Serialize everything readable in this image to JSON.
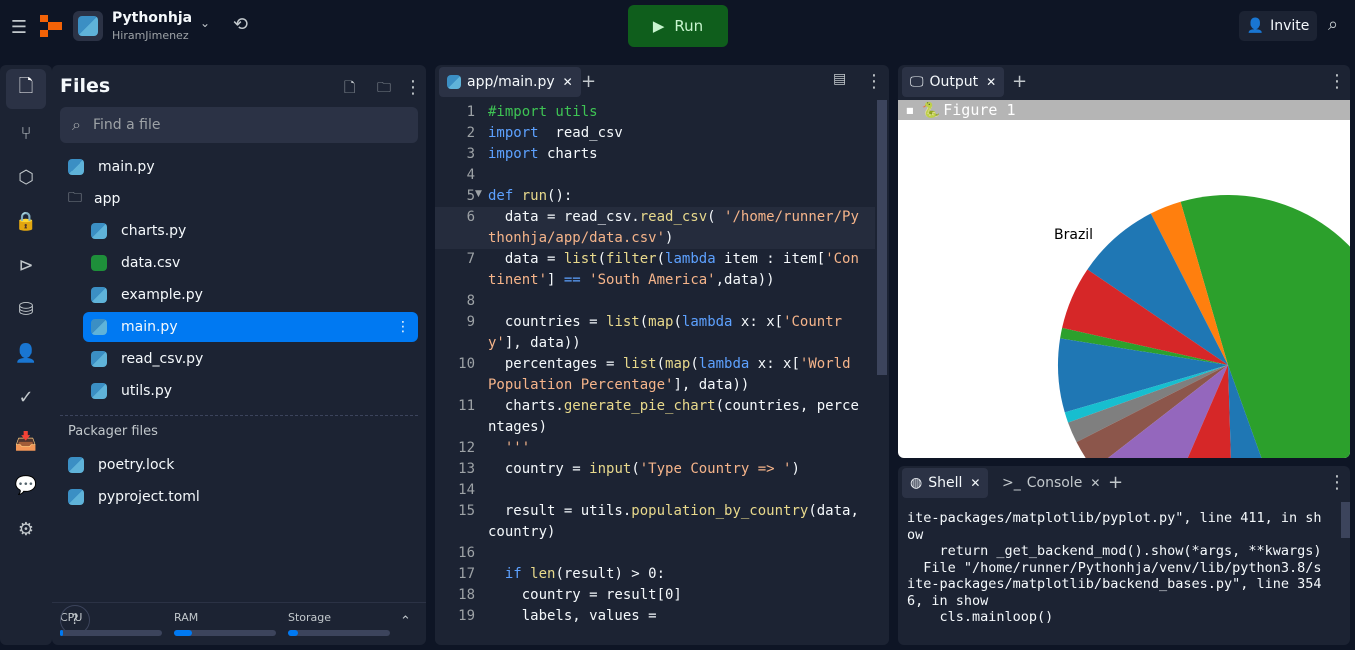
{
  "topbar": {
    "repl_name": "Pythonhja",
    "owner": "HiramJimenez",
    "run_label": "Run",
    "invite_label": "Invite"
  },
  "rail_icons": [
    "files-icon",
    "git-icon",
    "packages-icon",
    "secrets-icon",
    "debugger-icon",
    "database-icon",
    "auth-icon",
    "tests-icon",
    "inbox-icon",
    "chat-icon",
    "settings-icon"
  ],
  "files": {
    "title": "Files",
    "search_placeholder": "Find a file",
    "items": [
      {
        "name": "main.py",
        "type": "py",
        "indent": 0
      },
      {
        "name": "app",
        "type": "folder",
        "indent": 0
      },
      {
        "name": "charts.py",
        "type": "py",
        "indent": 1
      },
      {
        "name": "data.csv",
        "type": "csv",
        "indent": 1
      },
      {
        "name": "example.py",
        "type": "py",
        "indent": 1
      },
      {
        "name": "main.py",
        "type": "py",
        "indent": 1,
        "selected": true
      },
      {
        "name": "read_csv.py",
        "type": "py",
        "indent": 1
      },
      {
        "name": "utils.py",
        "type": "py",
        "indent": 1
      }
    ],
    "packager_title": "Packager files",
    "packager_items": [
      "poetry.lock",
      "pyproject.toml"
    ],
    "resources": [
      {
        "label": "CPU",
        "fill": 0.02
      },
      {
        "label": "RAM",
        "fill": 0.18
      },
      {
        "label": "Storage",
        "fill": 0.1
      }
    ]
  },
  "editor": {
    "tab": "app/main.py",
    "lines": [
      {
        "n": "1",
        "t": [
          [
            "cm",
            "#import utils"
          ]
        ]
      },
      {
        "n": "2",
        "t": [
          [
            "kw",
            "import"
          ],
          [
            "",
            "  read_csv"
          ]
        ]
      },
      {
        "n": "3",
        "t": [
          [
            "kw",
            "import"
          ],
          [
            "",
            " charts"
          ]
        ]
      },
      {
        "n": "4",
        "t": []
      },
      {
        "n": "5",
        "t": [
          [
            "kw",
            "def"
          ],
          [
            "",
            " "
          ],
          [
            "fn",
            "run"
          ],
          [
            "",
            "():"
          ]
        ]
      },
      {
        "n": "6",
        "t": [
          [
            "",
            "  data = "
          ],
          [
            "",
            "read_csv."
          ],
          [
            "fn",
            "read_csv"
          ],
          [
            "",
            "( "
          ],
          [
            "st",
            "'/home/runner/Pythonhja/app/data.csv'"
          ],
          [
            "",
            ")"
          ]
        ],
        "hl": true
      },
      {
        "n": "7",
        "t": [
          [
            "",
            "  data = "
          ],
          [
            "fn",
            "list"
          ],
          [
            "",
            "("
          ],
          [
            "fn",
            "filter"
          ],
          [
            "",
            "("
          ],
          [
            "kw",
            "lambda"
          ],
          [
            "",
            " item : item["
          ],
          [
            "st",
            "'Continent'"
          ],
          [
            "",
            "] "
          ],
          [
            "op",
            "=="
          ],
          [
            "",
            " "
          ],
          [
            "st",
            "'South America'"
          ],
          [
            "",
            ",data))"
          ]
        ]
      },
      {
        "n": "8",
        "t": []
      },
      {
        "n": "9",
        "t": [
          [
            "",
            "  countries = "
          ],
          [
            "fn",
            "list"
          ],
          [
            "",
            "("
          ],
          [
            "fn",
            "map"
          ],
          [
            "",
            "("
          ],
          [
            "kw",
            "lambda"
          ],
          [
            "",
            " x: x["
          ],
          [
            "st",
            "'Country'"
          ],
          [
            "",
            "], data))"
          ]
        ]
      },
      {
        "n": "10",
        "t": [
          [
            "",
            "  percentages = "
          ],
          [
            "fn",
            "list"
          ],
          [
            "",
            "("
          ],
          [
            "fn",
            "map"
          ],
          [
            "",
            "("
          ],
          [
            "kw",
            "lambda"
          ],
          [
            "",
            " x: x["
          ],
          [
            "st",
            "'World Population Percentage'"
          ],
          [
            "",
            "], data))"
          ]
        ]
      },
      {
        "n": "11",
        "t": [
          [
            "",
            "  charts."
          ],
          [
            "fn",
            "generate_pie_chart"
          ],
          [
            "",
            "(countries, percentages)"
          ]
        ]
      },
      {
        "n": "12",
        "t": [
          [
            "st",
            "  '''"
          ]
        ]
      },
      {
        "n": "13",
        "t": [
          [
            "",
            "  country = "
          ],
          [
            "fn",
            "input"
          ],
          [
            "",
            "("
          ],
          [
            "st",
            "'Type Country => '"
          ],
          [
            "",
            ")"
          ]
        ]
      },
      {
        "n": "14",
        "t": []
      },
      {
        "n": "15",
        "t": [
          [
            "",
            "  result = utils."
          ],
          [
            "fn",
            "population_by_country"
          ],
          [
            "",
            "(data, country)"
          ]
        ]
      },
      {
        "n": "16",
        "t": []
      },
      {
        "n": "17",
        "t": [
          [
            "",
            "  "
          ],
          [
            "kw",
            "if"
          ],
          [
            "",
            " "
          ],
          [
            "fn",
            "len"
          ],
          [
            "",
            "(result) > 0:"
          ]
        ]
      },
      {
        "n": "18",
        "t": [
          [
            "",
            "    country = result[0]"
          ]
        ]
      },
      {
        "n": "19",
        "t": [
          [
            "",
            "    labels, values ="
          ]
        ]
      }
    ]
  },
  "output": {
    "tab": "Output",
    "figure_title": "Figure 1"
  },
  "chart_data": {
    "type": "pie",
    "labels": [
      "Brazil"
    ],
    "slices": [
      {
        "label": "Brazil",
        "value": 49,
        "color": "#2ca02c"
      },
      {
        "value": 3,
        "color": "#ff7f0e"
      },
      {
        "value": 8,
        "color": "#1f77b4"
      },
      {
        "value": 6,
        "color": "#d62728"
      },
      {
        "value": 1,
        "color": "#2ca02c"
      },
      {
        "value": 7,
        "color": "#1f77b4"
      },
      {
        "value": 1,
        "color": "#17becf"
      },
      {
        "value": 2,
        "color": "#7f7f7f"
      },
      {
        "value": 3,
        "color": "#8c564b"
      },
      {
        "value": 8,
        "color": "#9467bd"
      },
      {
        "value": 7,
        "color": "#d62728"
      },
      {
        "value": 5,
        "color": "#1f77b4"
      }
    ]
  },
  "shell": {
    "tabs": [
      "Shell",
      "Console"
    ],
    "lines": [
      "ite-packages/matplotlib/pyplot.py\", line 411, in show",
      "    return _get_backend_mod().show(*args, **kwargs)",
      "  File \"/home/runner/Pythonhja/venv/lib/python3.8/site-packages/matplotlib/backend_bases.py\", line 3546, in show",
      "    cls.mainloop()"
    ]
  },
  "colors": {
    "run": "#0f5e1c",
    "selected": "#0079f2",
    "panel": "#1c2333",
    "bg": "#0e1525"
  }
}
